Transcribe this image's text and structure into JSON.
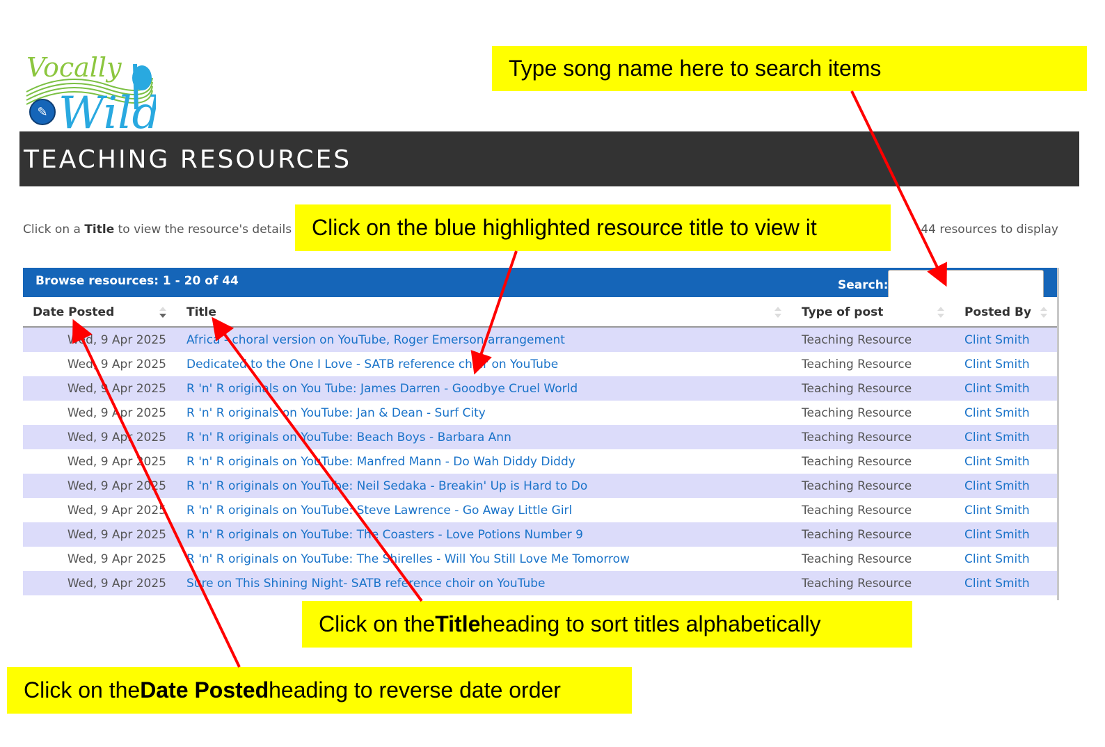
{
  "logo": {
    "text": "VocallyWild",
    "edit_icon": "pencil-square-icon"
  },
  "header": {
    "title": "TEACHING RESOURCES"
  },
  "hint": {
    "prefix": "Click on a ",
    "bold": "Title",
    "suffix": " to view the resource's details"
  },
  "resource_count": "44 resources to display",
  "panel": {
    "browse_label": "Browse resources: 1 - 20 of 44",
    "search_label": "Search:",
    "search_value": ""
  },
  "columns": {
    "date": "Date Posted",
    "title": "Title",
    "type": "Type of post",
    "by": "Posted By"
  },
  "rows": [
    {
      "date": "Wed, 9 Apr 2025",
      "title": "Africa - choral version on YouTube, Roger Emerson arrangement",
      "type": "Teaching Resource",
      "by": "Clint Smith"
    },
    {
      "date": "Wed, 9 Apr 2025",
      "title": "Dedicated to the One I Love - SATB reference choir on YouTube",
      "type": "Teaching Resource",
      "by": "Clint Smith"
    },
    {
      "date": "Wed, 9 Apr 2025",
      "title": "R 'n' R originals on You Tube: James Darren - Goodbye Cruel World",
      "type": "Teaching Resource",
      "by": "Clint Smith"
    },
    {
      "date": "Wed, 9 Apr 2025",
      "title": "R 'n' R originals on YouTube: Jan & Dean - Surf City",
      "type": "Teaching Resource",
      "by": "Clint Smith"
    },
    {
      "date": "Wed, 9 Apr 2025",
      "title": "R 'n' R originals on YouTube: Beach Boys - Barbara Ann",
      "type": "Teaching Resource",
      "by": "Clint Smith"
    },
    {
      "date": "Wed, 9 Apr 2025",
      "title": "R 'n' R originals on YouTube: Manfred Mann - Do Wah Diddy Diddy",
      "type": "Teaching Resource",
      "by": "Clint Smith"
    },
    {
      "date": "Wed, 9 Apr 2025",
      "title": "R 'n' R originals on YouTube: Neil Sedaka - Breakin' Up is Hard to Do",
      "type": "Teaching Resource",
      "by": "Clint Smith"
    },
    {
      "date": "Wed, 9 Apr 2025",
      "title": "R 'n' R originals on YouTube: Steve Lawrence - Go Away Little Girl",
      "type": "Teaching Resource",
      "by": "Clint Smith"
    },
    {
      "date": "Wed, 9 Apr 2025",
      "title": "R 'n' R originals on YouTube: The Coasters - Love Potions Number 9",
      "type": "Teaching Resource",
      "by": "Clint Smith"
    },
    {
      "date": "Wed, 9 Apr 2025",
      "title": "R 'n' R originals on YouTube: The Shirelles - Will You Still Love Me Tomorrow",
      "type": "Teaching Resource",
      "by": "Clint Smith"
    },
    {
      "date": "Wed, 9 Apr 2025",
      "title": "Sure on This Shining Night- SATB reference choir on YouTube",
      "type": "Teaching Resource",
      "by": "Clint Smith"
    }
  ],
  "callouts": {
    "search": "Type song name here to search items",
    "view": "Click on the blue highlighted resource title to view it",
    "title_sort": {
      "prefix": "Click on the ",
      "bold": "Title",
      "suffix": " heading to sort titles alphabetically"
    },
    "date_sort": {
      "prefix": "Click on the ",
      "bold": "Date Posted",
      "suffix": " heading to reverse date order"
    }
  },
  "colors": {
    "header_bg": "#333333",
    "panel_bar": "#1565b8",
    "row_alt": "#dcdcfa",
    "link": "#1a73c9",
    "callout_bg": "#ffff00",
    "arrow": "#ff0000"
  }
}
